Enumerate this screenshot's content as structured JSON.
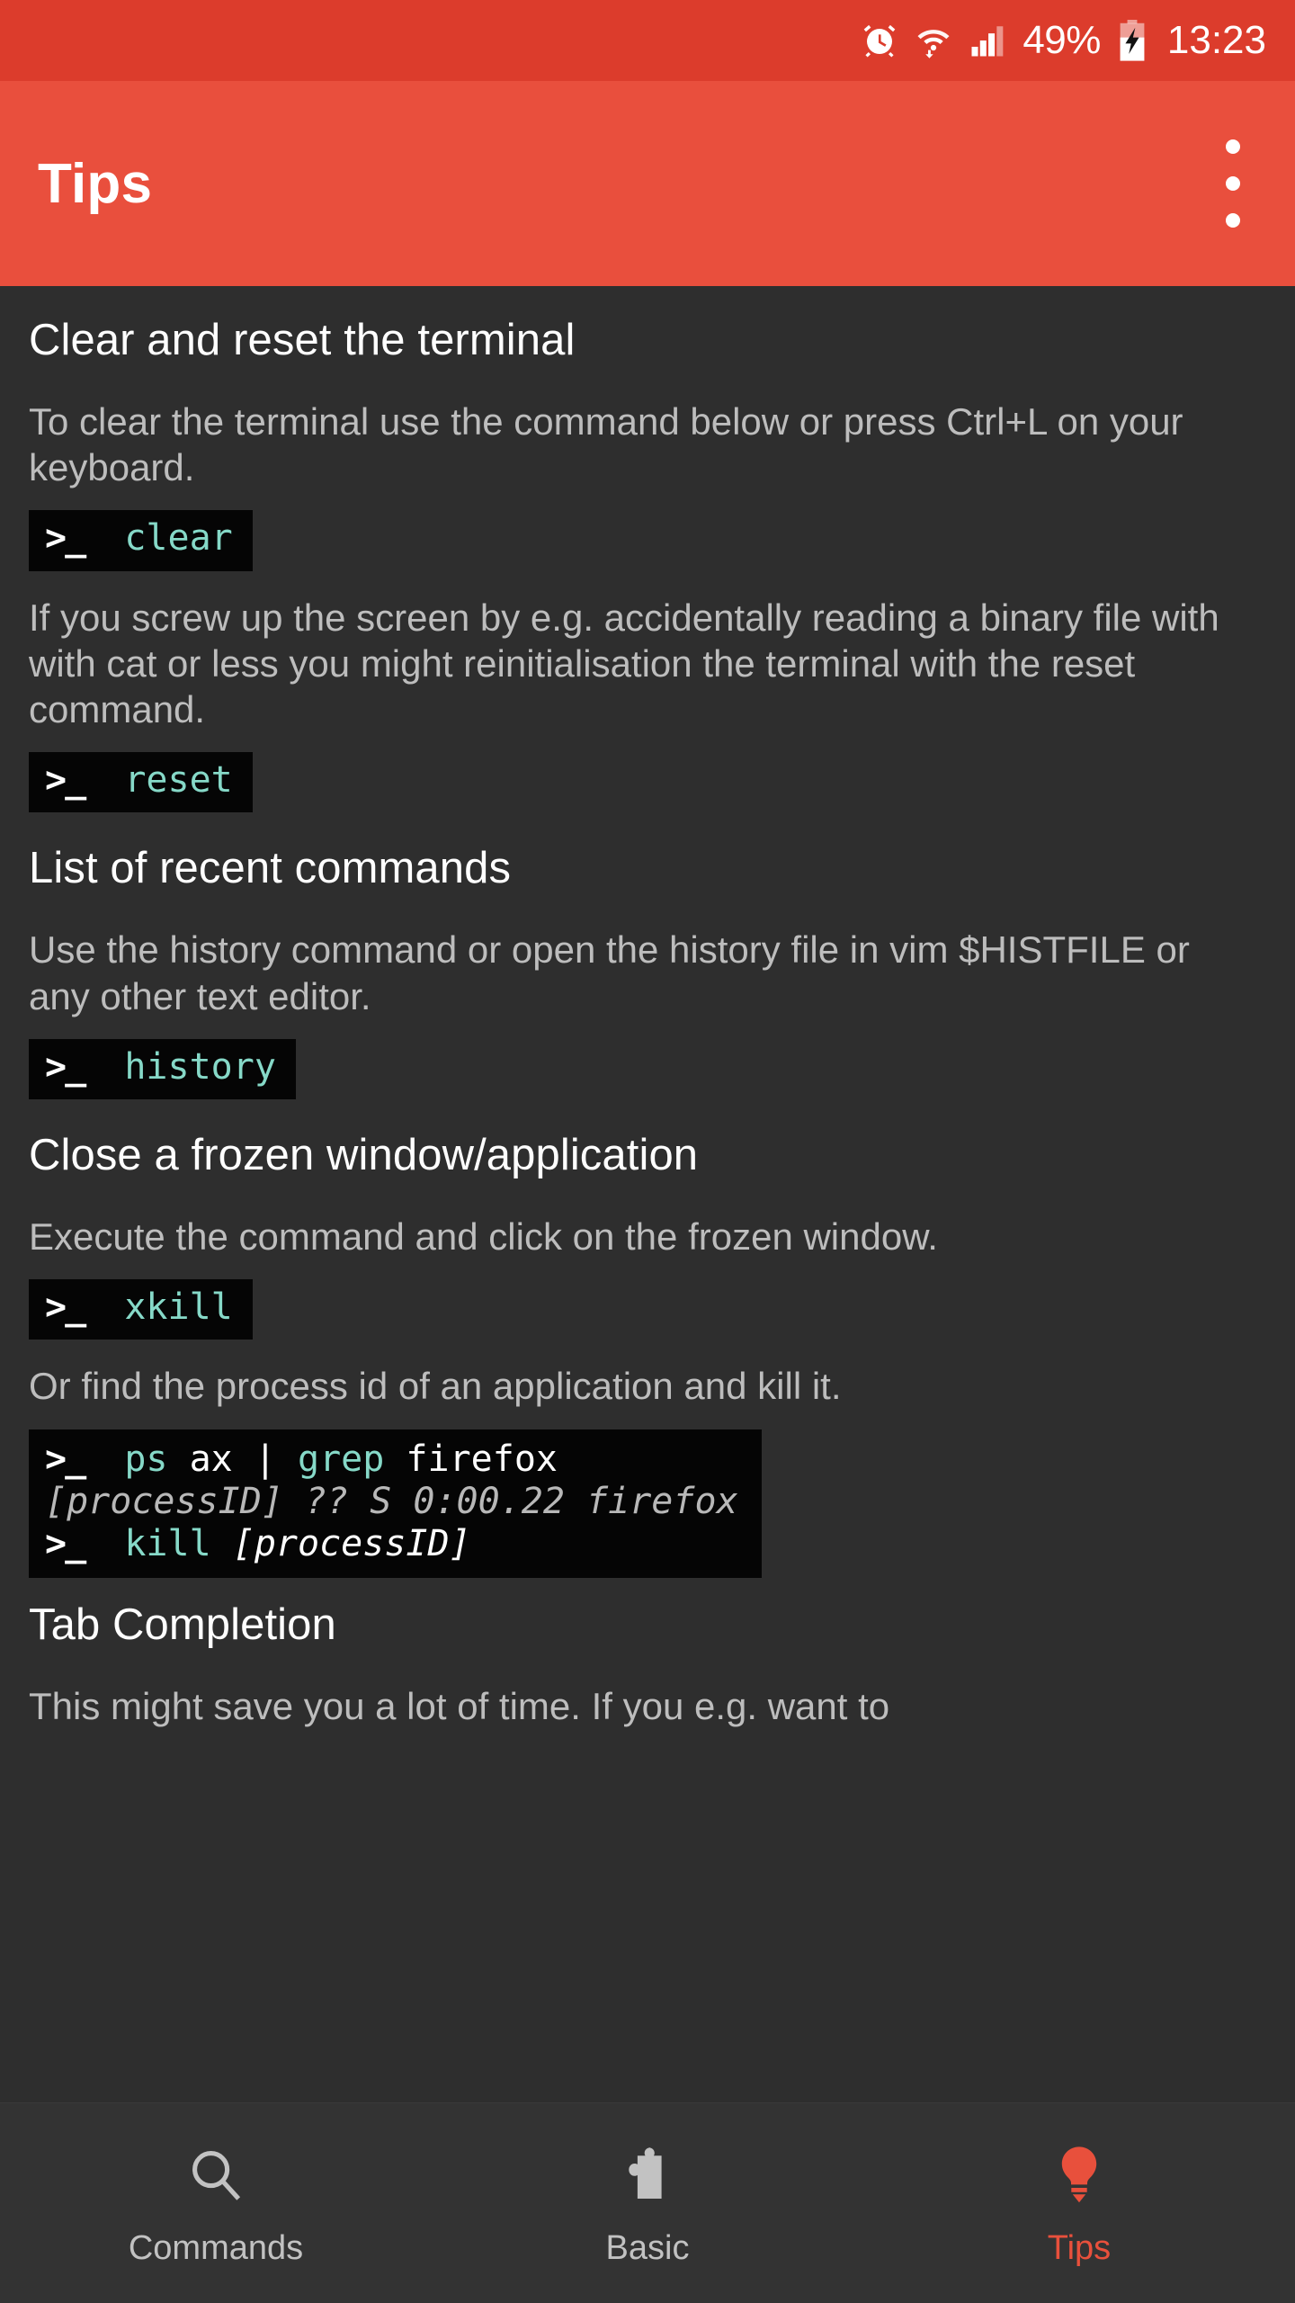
{
  "status_bar": {
    "icons": [
      "alarm-icon",
      "wifi-icon",
      "signal-icon",
      "battery-charging-icon"
    ],
    "battery_percent": "49%",
    "time": "13:23",
    "background": "#dc3c2c"
  },
  "app_bar": {
    "title": "Tips",
    "overflow_label": "More options",
    "background": "#e94f3d"
  },
  "theme": {
    "content_background": "#2e2e2e",
    "heading_color": "#fefefe",
    "body_color": "#bdbdbd",
    "code_background": "#050505",
    "code_accent": "#86d9c8",
    "accent": "#e8503c"
  },
  "sections": [
    {
      "title": "Clear and reset the terminal",
      "blocks": [
        {
          "kind": "paragraph",
          "text": "To clear the terminal use the command below or press Ctrl+L on your keyboard."
        },
        {
          "kind": "code",
          "lines": [
            {
              "prompt": ">_",
              "parts": [
                {
                  "style": "cmd",
                  "text": "clear"
                }
              ]
            }
          ]
        },
        {
          "kind": "paragraph",
          "text": "If you screw up the screen by e.g. accidentally reading a binary file with with cat or less you might reinitialisation the terminal with the reset command."
        },
        {
          "kind": "code",
          "lines": [
            {
              "prompt": ">_",
              "parts": [
                {
                  "style": "cmd",
                  "text": "reset"
                }
              ]
            }
          ]
        }
      ]
    },
    {
      "title": "List of recent commands",
      "blocks": [
        {
          "kind": "paragraph",
          "text": "Use the history command or open the history file in vim $HISTFILE or any other text editor."
        },
        {
          "kind": "code",
          "lines": [
            {
              "prompt": ">_",
              "parts": [
                {
                  "style": "cmd",
                  "text": "history"
                }
              ]
            }
          ]
        }
      ]
    },
    {
      "title": "Close a frozen window/application",
      "blocks": [
        {
          "kind": "paragraph",
          "text": "Execute the command and click on the frozen window."
        },
        {
          "kind": "code",
          "lines": [
            {
              "prompt": ">_",
              "parts": [
                {
                  "style": "cmd",
                  "text": "xkill"
                }
              ]
            }
          ]
        },
        {
          "kind": "paragraph",
          "text": "Or find the process id of an application and kill it."
        },
        {
          "kind": "code",
          "multiline": true,
          "lines": [
            {
              "prompt": ">_",
              "parts": [
                {
                  "style": "cmd",
                  "text": "ps"
                },
                {
                  "style": "plain",
                  "text": " ax | "
                },
                {
                  "style": "cmd",
                  "text": "grep"
                },
                {
                  "style": "plain",
                  "text": " firefox"
                }
              ]
            },
            {
              "prompt": "",
              "parts": [
                {
                  "style": "out",
                  "text": "[processID] ?? S 0:00.22 firefox"
                }
              ]
            },
            {
              "prompt": ">_",
              "parts": [
                {
                  "style": "cmd",
                  "text": "kill"
                },
                {
                  "style": "arg",
                  "text": " [processID]"
                }
              ]
            }
          ]
        }
      ]
    },
    {
      "title": "Tab Completion",
      "blocks": [
        {
          "kind": "paragraph",
          "text": "This might save you a lot of time. If you e.g. want to"
        }
      ]
    }
  ],
  "bottom_nav": {
    "items": [
      {
        "label": "Commands",
        "icon": "search-icon",
        "active": false
      },
      {
        "label": "Basic",
        "icon": "puzzle-piece-icon",
        "active": false
      },
      {
        "label": "Tips",
        "icon": "lightbulb-icon",
        "active": true
      }
    ]
  }
}
